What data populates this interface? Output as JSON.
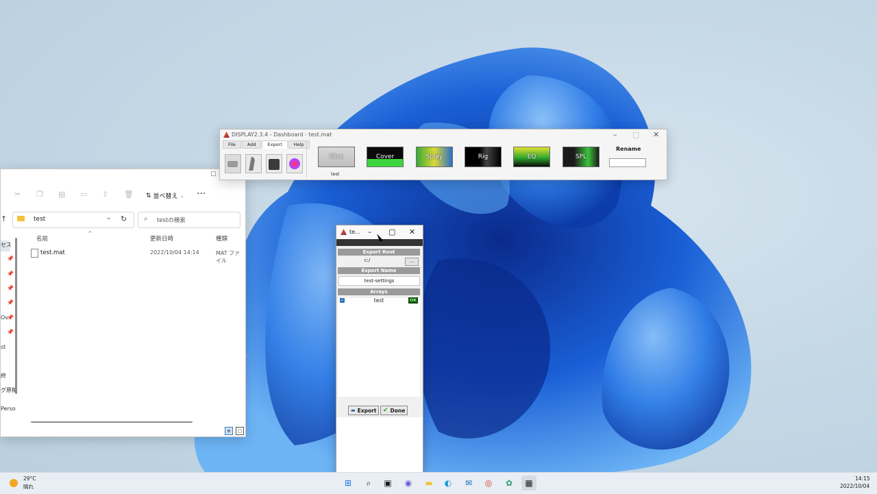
{
  "explorer": {
    "sort_label": "並べ替え",
    "address": "test",
    "search_placeholder": "testの検索",
    "columns": {
      "name": "名前",
      "modified": "更新日時",
      "type": "種類"
    },
    "files": [
      {
        "name": "test.mat",
        "modified": "2022/10/04 14:14",
        "type": "MAT ファイル"
      }
    ],
    "nav_items": [
      "セス",
      "Ov",
      "st",
      "終",
      "グ原稿",
      "Perso"
    ]
  },
  "dashboard": {
    "title": "DISPLAY2.3.4 - Dashboard - test.mat",
    "menu": [
      "File",
      "Add",
      "Export",
      "Help"
    ],
    "active_menu": "Export",
    "buttons": [
      "Slice",
      "Cover",
      "Splay",
      "Rig",
      "EQ",
      "SPL"
    ],
    "rename_label": "Rename",
    "rename_value": "",
    "array_label": "test"
  },
  "export_dialog": {
    "title": "te...",
    "export_root_header": "Export Root",
    "export_root_value": "c:/",
    "browse_label": "...",
    "export_name_header": "Export Name",
    "export_name_value": "test-settings",
    "arrays_header": "Arrays",
    "arrays": [
      {
        "name": "test",
        "checked": true,
        "status": "OK"
      }
    ],
    "export_button": "Export",
    "done_button": "Done"
  },
  "taskbar": {
    "weather_temp": "29°C",
    "weather_desc": "晴れ",
    "time": "14:15",
    "date": "2022/10/04",
    "apps": [
      "start-icon",
      "search-icon",
      "task-view-icon",
      "chat-icon",
      "file-explorer-icon",
      "edge-icon",
      "outlook-icon",
      "chrome-icon",
      "app-icon",
      "display-app-icon"
    ]
  },
  "colors": {
    "wallpaper_blue": "#1a5fd6",
    "ok_bg": "#0b4a0b",
    "ok_text": "#8cff8c",
    "section_header": "#9a9a9a"
  }
}
